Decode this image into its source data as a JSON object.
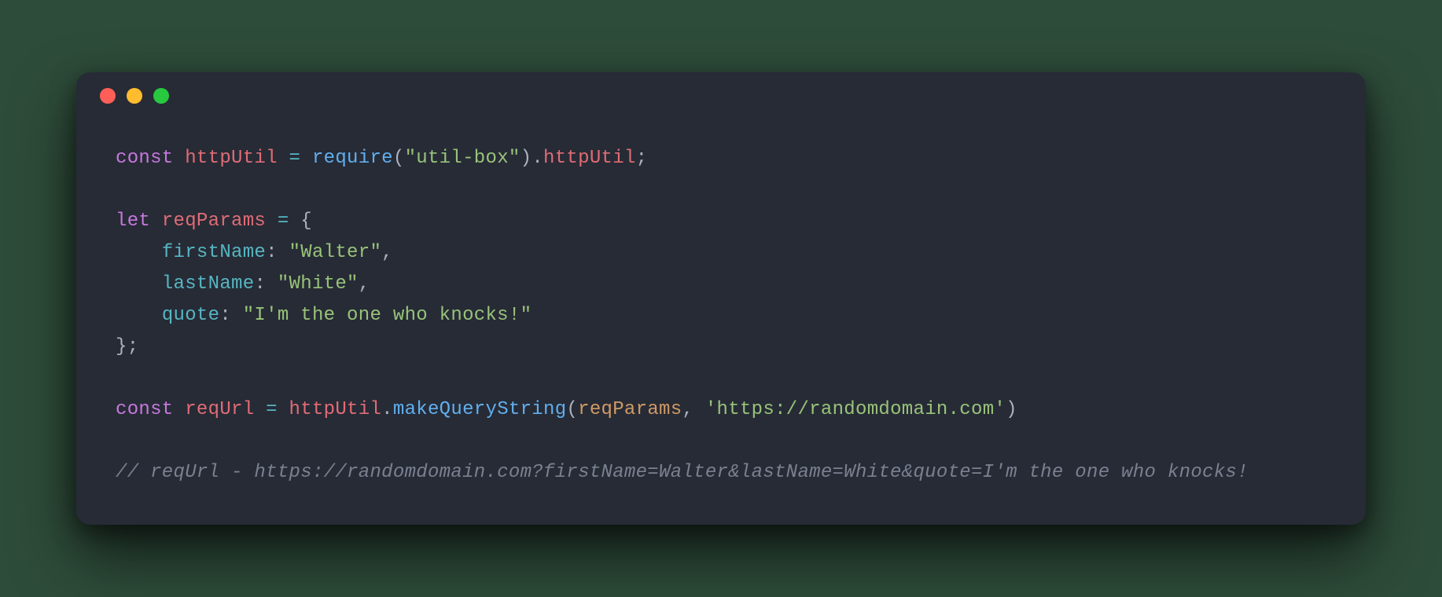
{
  "colors": {
    "background": "#2e4c3a",
    "window": "#272b36",
    "close": "#ff5f56",
    "minimize": "#ffbd2e",
    "maximize": "#27c93f",
    "keyword": "#c678dd",
    "variable": "#e06c75",
    "function": "#61afef",
    "string": "#98c379",
    "property": "#56b6c2",
    "param": "#d19a66",
    "punct": "#abb2bf",
    "comment": "#7a8090"
  },
  "line1": {
    "kw_const": "const",
    "var_httpUtil": "httpUtil",
    "eq": " = ",
    "fn_require": "require",
    "lp": "(",
    "str_utilbox": "\"util-box\"",
    "rp": ")",
    "dot": ".",
    "prop_httpUtil": "httpUtil",
    "semi": ";"
  },
  "line3": {
    "kw_let": "let",
    "var_reqParams": "reqParams",
    "eq": " = ",
    "brace": "{"
  },
  "line4": {
    "indent": "    ",
    "key": "firstName",
    "colon": ": ",
    "val": "\"Walter\"",
    "comma": ","
  },
  "line5": {
    "indent": "    ",
    "key": "lastName",
    "colon": ": ",
    "val": "\"White\"",
    "comma": ","
  },
  "line6": {
    "indent": "    ",
    "key": "quote",
    "colon": ": ",
    "val": "\"I'm the one who knocks!\""
  },
  "line7": {
    "brace": "}",
    "semi": ";"
  },
  "line9": {
    "kw_const": "const",
    "var_reqUrl": "reqUrl",
    "eq": " = ",
    "obj": "httpUtil",
    "dot": ".",
    "fn": "makeQueryString",
    "lp": "(",
    "arg1": "reqParams",
    "comma": ", ",
    "arg2": "'https://randomdomain.com'",
    "rp": ")"
  },
  "line11": {
    "comment": "// reqUrl - https://randomdomain.com?firstName=Walter&lastName=White&quote=I'm the one who knocks!"
  }
}
